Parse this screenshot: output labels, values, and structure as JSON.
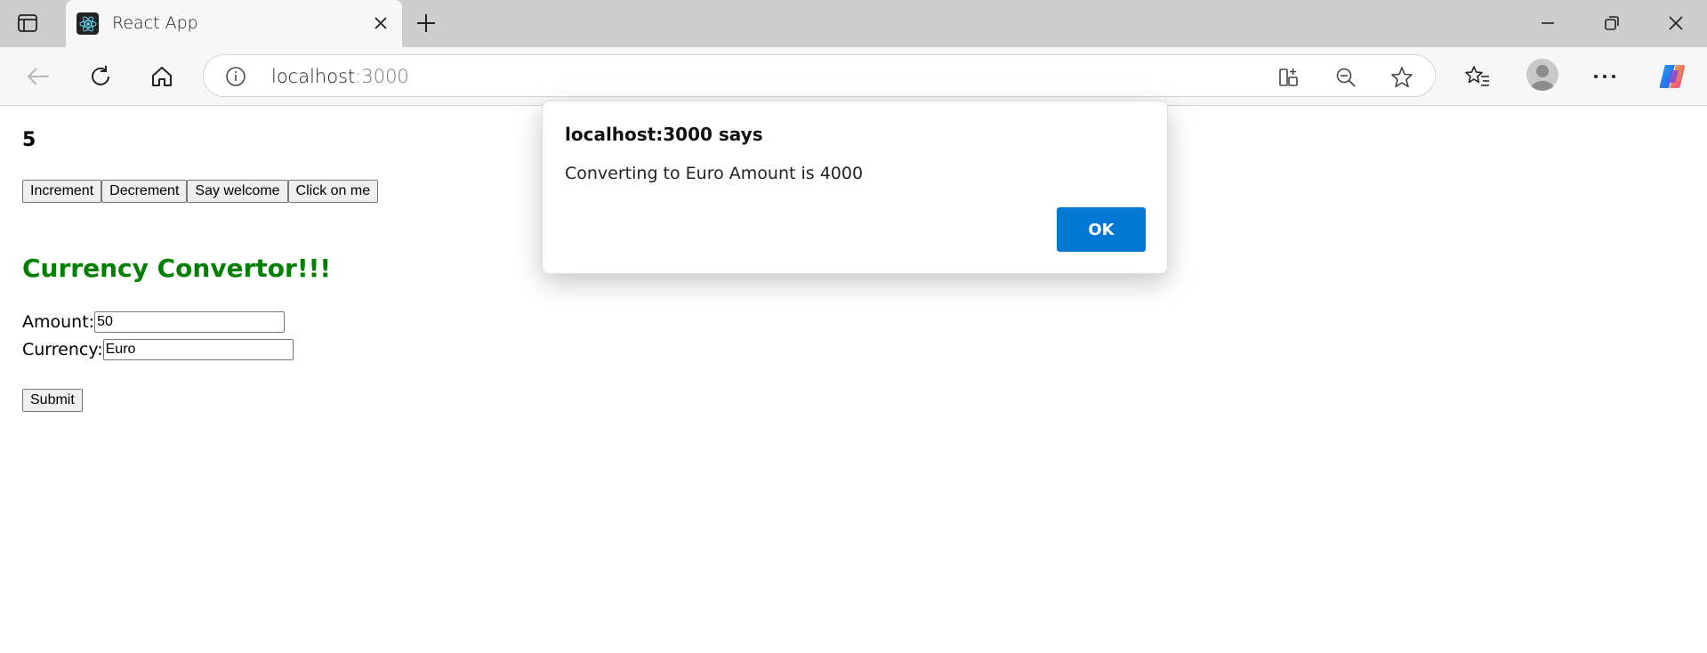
{
  "browser": {
    "tab": {
      "title": "React App",
      "favicon": "react-logo-icon"
    },
    "url": {
      "host": "localhost",
      "port": ":3000"
    },
    "icons": [
      "tab-actions-icon",
      "close-icon",
      "plus-icon",
      "minimize-icon",
      "restore-icon",
      "close-window-icon",
      "back-arrow-icon",
      "refresh-icon",
      "home-icon",
      "info-icon",
      "split-screen-icon",
      "zoom-out-icon",
      "star-icon",
      "favorites-icon",
      "profile-icon",
      "more-icon",
      "copilot-icon"
    ]
  },
  "page": {
    "counter": "5",
    "buttons": {
      "increment": "Increment",
      "decrement": "Decrement",
      "say_welcome": "Say welcome",
      "click_on_me": "Click on me"
    },
    "heading": "Currency Convertor!!!",
    "amount_label": "Amount:",
    "amount_value": "50",
    "currency_label": "Currency:",
    "currency_value": "Euro",
    "submit": "Submit"
  },
  "dialog": {
    "title": "localhost:3000 says",
    "message": "Converting to Euro Amount is 4000",
    "ok": "OK"
  },
  "colors": {
    "heading": "#008000",
    "ok_button": "#0078d4"
  }
}
